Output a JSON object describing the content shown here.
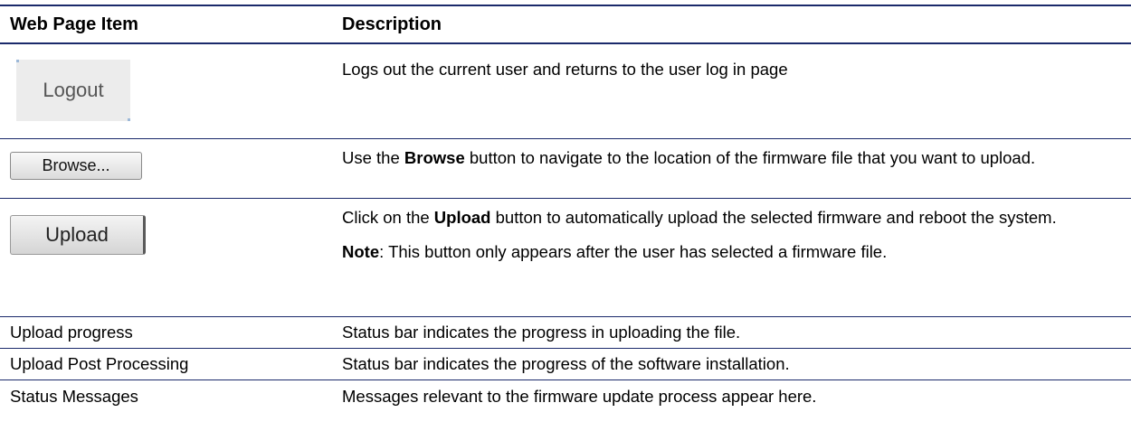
{
  "header": {
    "col_item": "Web Page Item",
    "col_desc": "Description"
  },
  "rows": [
    {
      "button_label": "Logout",
      "desc": "Logs out the current user and returns to the user log in page"
    },
    {
      "button_label": "Browse...",
      "desc_pre": "Use the ",
      "desc_bold": "Browse",
      "desc_post": " button to navigate to the location of the firmware file that you want to upload."
    },
    {
      "button_label": "Upload",
      "desc_pre": "Click on the ",
      "desc_bold": "Upload",
      "desc_post": " button to automatically upload the selected firmware and reboot the system.",
      "note_bold": "Note",
      "note_text": ": This button only appears after the user has selected a firmware file."
    },
    {
      "item": "Upload progress",
      "desc": "Status bar indicates the progress in uploading the file."
    },
    {
      "item": "Upload Post Processing",
      "desc": "Status bar indicates the progress of the software installation."
    },
    {
      "item": "Status Messages",
      "desc": "Messages relevant to the firmware update process appear here."
    }
  ]
}
